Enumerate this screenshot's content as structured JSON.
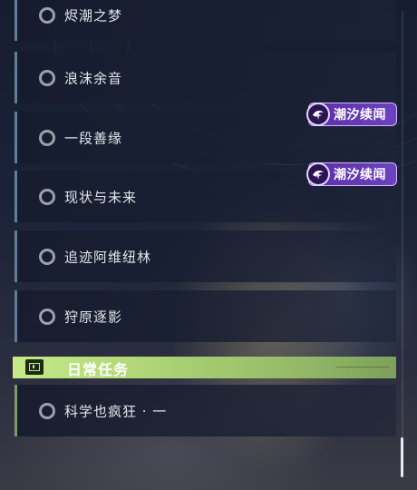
{
  "quests": [
    {
      "label": "烬潮之梦"
    },
    {
      "label": "浪沫余音"
    },
    {
      "label": "一段善缘"
    },
    {
      "label": "现状与未来"
    },
    {
      "label": "追迹阿维纽林"
    },
    {
      "label": "狩原逐影"
    }
  ],
  "badges": [
    {
      "label": "潮汐续闻"
    },
    {
      "label": "潮汐续闻"
    }
  ],
  "daily_section": {
    "title": "日常任务",
    "quests": [
      {
        "label": "科学也疯狂 · 一"
      }
    ]
  },
  "colors": {
    "accent_bar": "#5f7f99",
    "daily_accent": "#c6ea88",
    "badge_purple": "#6d42bf"
  },
  "icons": {
    "quest_status": "circle-outline-icon",
    "daily_header": "task-board-icon",
    "badge": "spark-swirl-icon"
  }
}
